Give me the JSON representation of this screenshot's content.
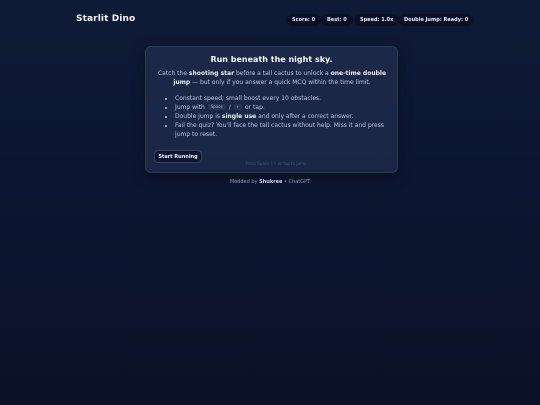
{
  "header": {
    "brand": "Starlit Dino",
    "score": "Score: 0",
    "best": "Best: 0",
    "speed": "Speed: 1.0x",
    "double_jump": "Double Jump: Ready: 0"
  },
  "intro_card": {
    "title": "Run beneath the night sky.",
    "intro": {
      "t1": "Catch the ",
      "b1": "shooting star",
      "t2": " before a tall cactus to unlock a ",
      "b2": "one-time double jump",
      "t3": " — but only if you answer a quick MCQ within the time limit."
    },
    "rules": {
      "r1": "Constant speed; small boost every 10 obstacles.",
      "r2_pre": "Jump with ",
      "r2_key1": "Space",
      "r2_sep": " / ",
      "r2_key2": "↑",
      "r2_post": " or tap.",
      "r3_pre": "Double jump is ",
      "r3_bold": "single use",
      "r3_post": " and only after a correct answer.",
      "r4": "Fail the quiz? You'll face the tall cactus without help. Miss it and press jump to reset."
    },
    "start_button": "Start Running",
    "hint": "Press Space / ↑ or tap to jump"
  },
  "footer": {
    "pre": "Modded by ",
    "author": "Shukree",
    "post": " • ChatGPT"
  },
  "colors": {
    "background": "#0c1630",
    "card": "#28345 6",
    "accent_text": "#e9eeff",
    "muted_text": "#b9c4e4"
  }
}
